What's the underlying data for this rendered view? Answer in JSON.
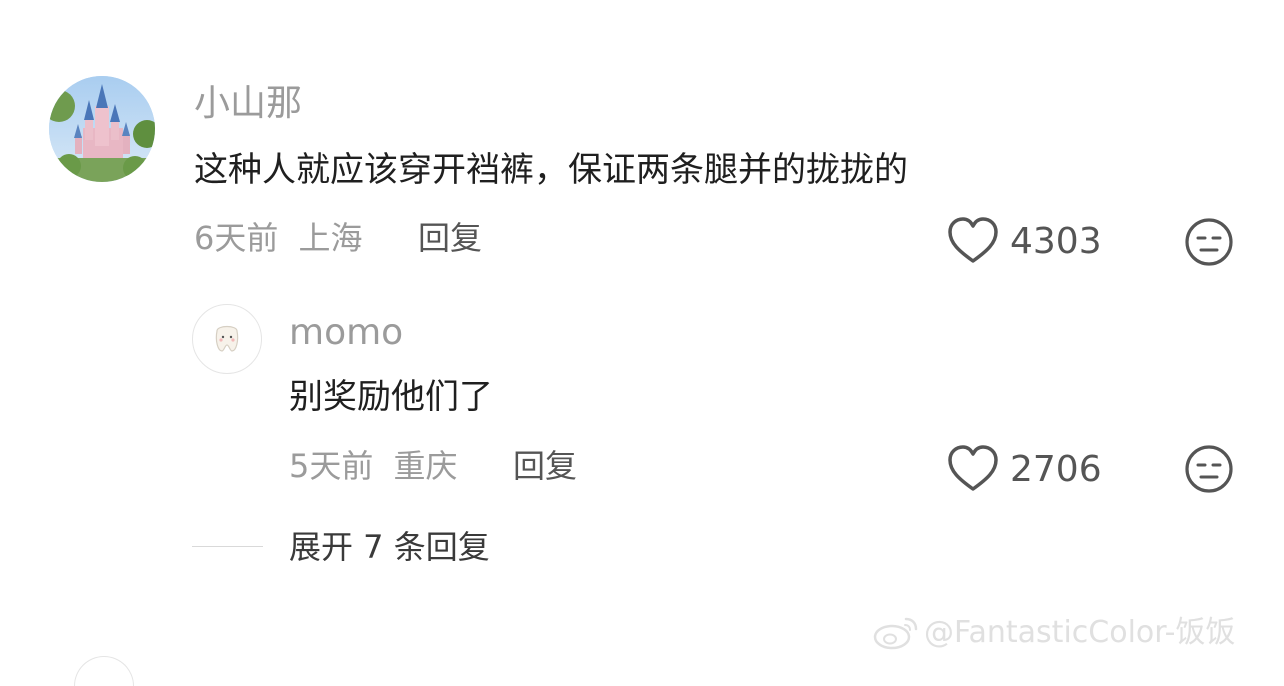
{
  "comment": {
    "username": "小山那",
    "text": "这种人就应该穿开裆裤，保证两条腿并的拢拢的",
    "time": "6天前",
    "location": "上海",
    "reply_label": "回复",
    "likes": "4303"
  },
  "reply": {
    "username": "momo",
    "text": "别奖励他们了",
    "time": "5天前",
    "location": "重庆",
    "reply_label": "回复",
    "likes": "2706"
  },
  "expand_label": "展开 7 条回复",
  "watermark": "@FantasticColor-饭饭",
  "icons": {
    "like": "heart-outline-icon",
    "dislike": "neutral-face-icon",
    "watermark_logo": "weibo-logo-icon"
  },
  "colors": {
    "username": "#9b9b9b",
    "text": "#1f1f1f",
    "meta": "#9b9b9b",
    "reply": "#555555"
  }
}
